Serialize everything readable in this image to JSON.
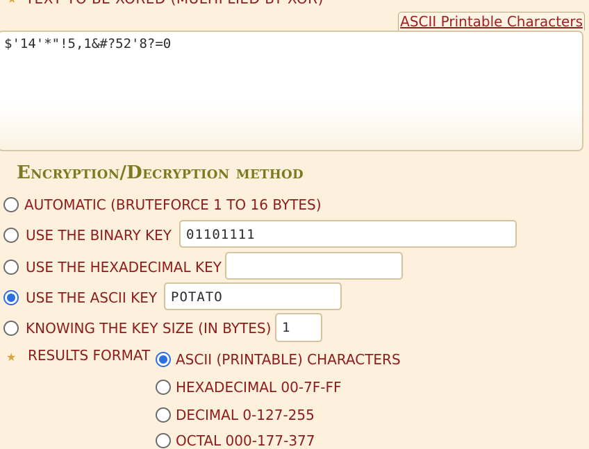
{
  "header": {
    "label": "TEXT TO BE XORED (MULTIPLIED BY XOR)"
  },
  "charset_link": "ASCII Printable Characters",
  "input_text": "$'14'*\"!5,1&#?52'8?=0",
  "method": {
    "title": "Encryption/Decryption method",
    "options": [
      {
        "label": "AUTOMATIC (BRUTEFORCE 1 TO 16 BYTES)",
        "checked": false
      },
      {
        "label": "USE THE BINARY KEY",
        "value": "01101111",
        "checked": false
      },
      {
        "label": "USE THE HEXADECIMAL KEY",
        "value": "",
        "checked": false
      },
      {
        "label": "USE THE ASCII KEY",
        "value": "POTATO",
        "checked": true
      },
      {
        "label": "KNOWING THE KEY SIZE (IN BYTES)",
        "value": "1",
        "checked": false
      }
    ]
  },
  "results": {
    "label": "RESULTS FORMAT",
    "options": [
      {
        "label": "ASCII (PRINTABLE) CHARACTERS",
        "checked": true
      },
      {
        "label": "HEXADECIMAL 00-7F-FF",
        "checked": false
      },
      {
        "label": "DECIMAL 0-127-255",
        "checked": false
      },
      {
        "label": "OCTAL 000-177-377",
        "checked": false
      }
    ]
  },
  "colors": {
    "accent": "#8c1c1c",
    "title": "#7b7a20",
    "radio_selected": "#2b6fe0",
    "background": "#fdf0dd"
  }
}
